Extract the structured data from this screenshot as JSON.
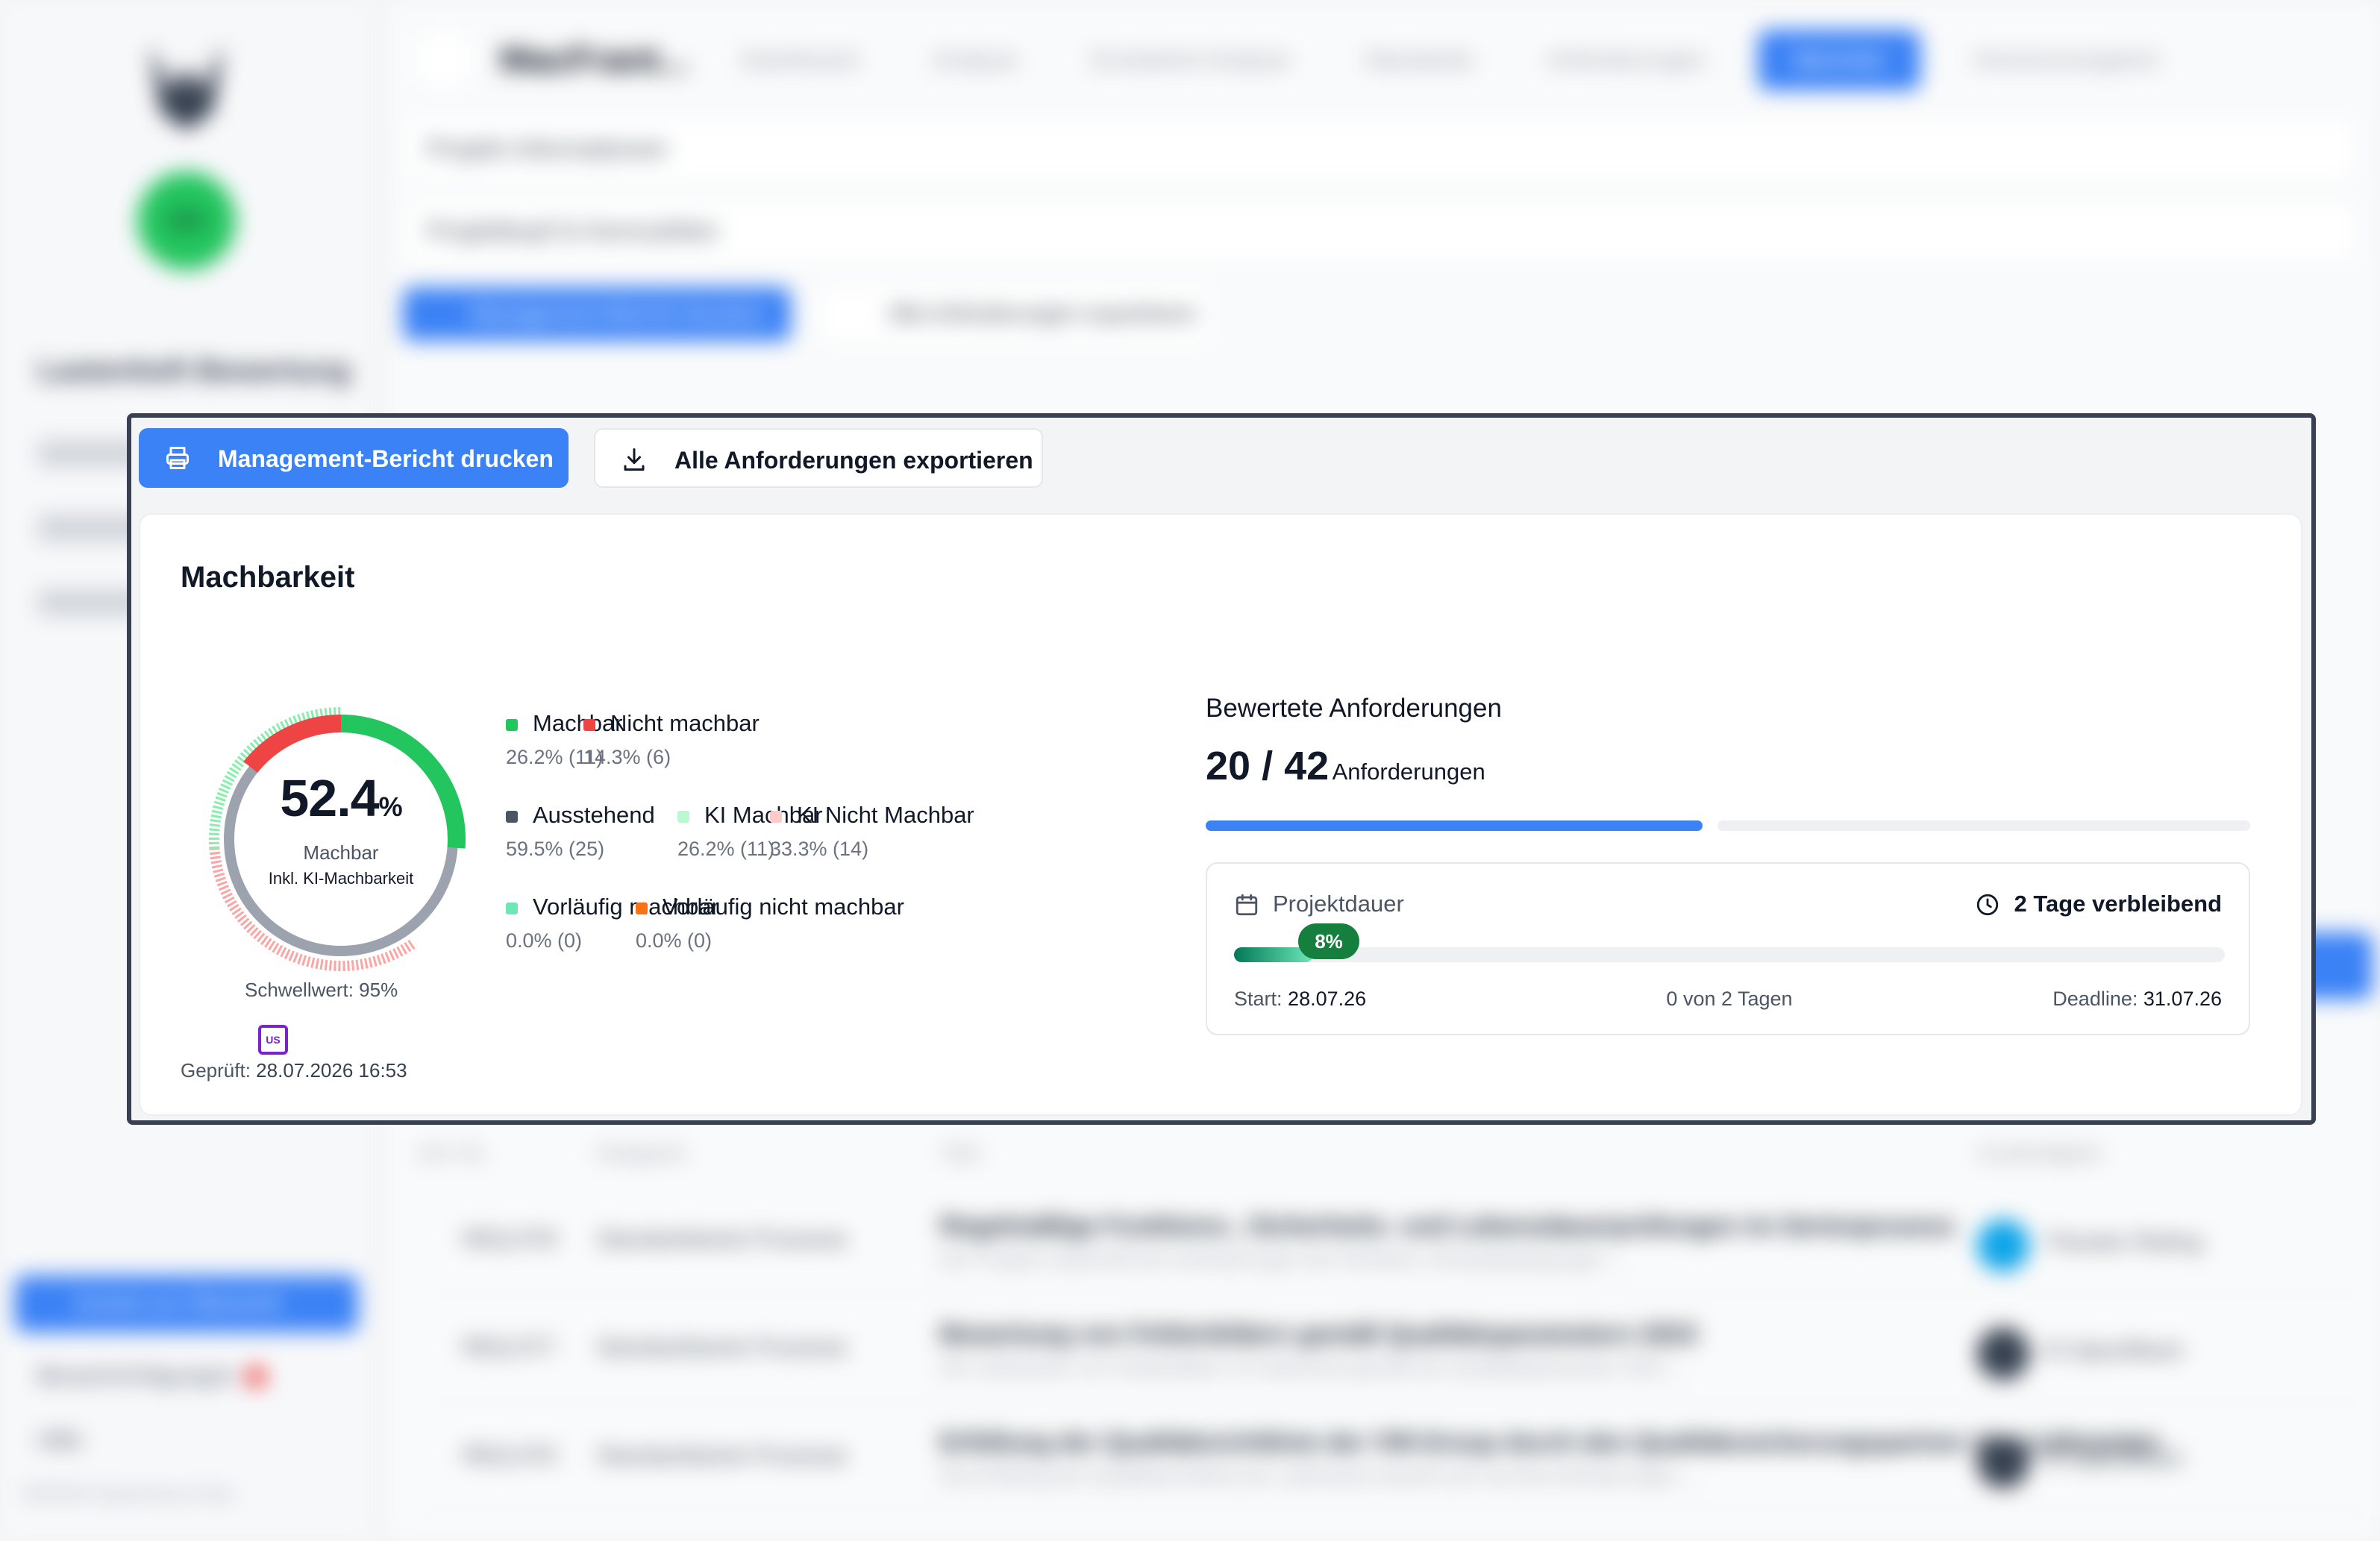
{
  "background": {
    "sidebar": {
      "avatar_initials": "SH",
      "title": "Lastenheft Bewertung",
      "primary_button": "Zurück zur Übersicht",
      "links": [
        "Benachrichtigungen",
        "Hilfe"
      ],
      "footer": "MARINE Engineering & Data"
    },
    "header": {
      "project_title": "MacFrant...",
      "tabs": [
        "Dashboard",
        "Analyse",
        "Erweiterte Analyse",
        "Standards",
        "Anforderungen"
      ],
      "active_tab": "Berichte",
      "last_tab": "Versionsvergleich"
    },
    "panels": [
      "Projekt Informationen",
      "Projektkopf & Kennzahlen"
    ],
    "table": {
      "columns": [
        "Anf.-Nr.",
        "Kategorie",
        "Titel",
        "Zuständigkeit"
      ],
      "rows": [
        {
          "id": "REQ-078",
          "category": "Standardisierte Prozesse",
          "title": "Regelmäßige Funktions-, Sicherheits- und Lebensdauerprüfungen im Serienprozess",
          "subtitle": "Der Projekt-Lastenheft der Anforderungen der Richtlinie, Einsatzbedingungen ...",
          "assignee": "Theodor Rieling",
          "avatar": "blue"
        },
        {
          "id": "REQ-077",
          "category": "Standardisierte Prozesse",
          "title": "Bewertung von Fehlerbildern gemäß Qualitätsparametern 2023",
          "subtitle": "Die Lieferanten von Fehlerbildern im Dokument gemäß der Qualitätsparameter 2023 ...",
          "assignee": "KI-Spezifikant",
          "avatar": "dark"
        },
        {
          "id": "REQ-076",
          "category": "Standardisierte Prozesse",
          "title": "Erfüllung der Qualitätsrichtlinie der VW-Group durch den Qualitätssicherungspartner des Lieferanten",
          "subtitle": "Die Erfüllung der Qualitätsrichtlinie der Lieferanten bezieht sich auf die Anforderungen ...",
          "assignee": "KI-Spezifikant",
          "avatar": "dark"
        }
      ]
    }
  },
  "actions": {
    "print_label": "Management-Bericht drucken",
    "export_label": "Alle Anforderungen exportieren"
  },
  "feasibility": {
    "title": "Machbarkeit",
    "percent": "52.4",
    "percent_unit": "%",
    "center_label": "Machbar",
    "center_sub": "Inkl. KI-Machbarkeit",
    "threshold": "Schwellwert: 95%",
    "checked_label": "Geprüft:",
    "checked_value": "28.07.2026 16:53",
    "user_badge": "US",
    "legend": [
      {
        "name": "Machbar",
        "value": "26.2% (11)",
        "color": "#22c55e"
      },
      {
        "name": "Nicht machbar",
        "value": "14.3% (6)",
        "color": "#ef4444"
      },
      {
        "name": "Ausstehend",
        "value": "59.5% (25)",
        "color": "#4b5563"
      },
      {
        "name": "KI Machbar",
        "value": "26.2% (11)",
        "color": "#bbf7d0"
      },
      {
        "name": "KI Nicht Machbar",
        "value": "33.3% (14)",
        "color": "#fecaca"
      },
      {
        "name": "Vorläufig machbar",
        "value": "0.0% (0)",
        "color": "#6ee7b7"
      },
      {
        "name": "Vorläufig nicht machbar",
        "value": "0.0% (0)",
        "color": "#f97316"
      }
    ],
    "ring": {
      "outer": [
        {
          "label": "Machbar",
          "fraction": 0.262,
          "color": "#22c55e"
        },
        {
          "label": "Nicht machbar",
          "fraction": 0.143,
          "color": "#ef4444"
        }
      ],
      "inner_color": "#9ca3af",
      "ki_outer": [
        {
          "label": "KI Nicht Machbar",
          "fraction": 0.333,
          "color": "#fca5a5"
        },
        {
          "label": "KI Machbar",
          "fraction": 0.262,
          "color": "#86efac"
        }
      ]
    }
  },
  "evaluated": {
    "title": "Bewertete Anforderungen",
    "count": "20 / 42",
    "unit": "Anforderungen",
    "fraction": 0.476
  },
  "duration": {
    "title": "Projektdauer",
    "remaining": "2 Tage verbleibend",
    "progress_pct": 8,
    "progress_label": "8%",
    "start_label": "Start:",
    "start_value": "28.07.26",
    "middle": "0 von 2 Tagen",
    "end_label": "Deadline:",
    "end_value": "31.07.26"
  }
}
